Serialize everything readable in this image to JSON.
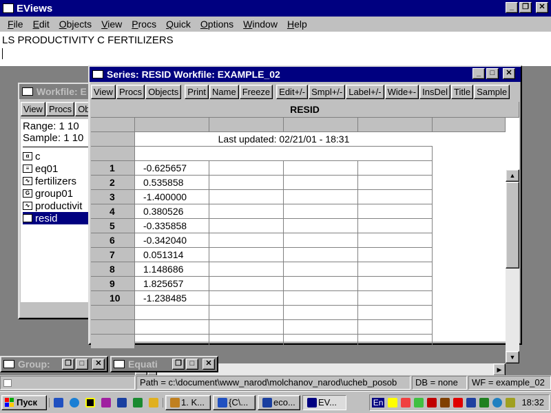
{
  "app": {
    "title": "EViews"
  },
  "menu": [
    "File",
    "Edit",
    "Objects",
    "View",
    "Procs",
    "Quick",
    "Options",
    "Window",
    "Help"
  ],
  "command": {
    "text": "LS PRODUCTIVITY C  FERTILIZERS"
  },
  "workfile_window": {
    "title": "Workfile: E",
    "toolbar": [
      "View",
      "Procs",
      "Ob"
    ],
    "range": "Range:   1 10",
    "sample": "Sample: 1 10",
    "items": [
      {
        "icon": "alpha",
        "name": "c"
      },
      {
        "icon": "eq",
        "name": "eq01"
      },
      {
        "icon": "series",
        "name": "fertilizers"
      },
      {
        "icon": "group",
        "name": "group01"
      },
      {
        "icon": "series",
        "name": "productivit"
      },
      {
        "icon": "series",
        "name": "resid",
        "selected": true
      }
    ]
  },
  "series_window": {
    "title": "Series: RESID   Workfile: EXAMPLE_02",
    "toolbar": [
      "View",
      "Procs",
      "Objects",
      "Print",
      "Name",
      "Freeze",
      "Edit+/-",
      "Smpl+/-",
      "Label+/-",
      "Wide+-",
      "InsDel",
      "Title",
      "Sample"
    ],
    "header": "RESID",
    "last_updated": "Last updated: 02/21/01 - 18:31",
    "rows": [
      {
        "obs": "1",
        "value": "-0.625657"
      },
      {
        "obs": "2",
        "value": "0.535858"
      },
      {
        "obs": "3",
        "value": "-1.400000"
      },
      {
        "obs": "4",
        "value": "0.380526"
      },
      {
        "obs": "5",
        "value": "-0.335858"
      },
      {
        "obs": "6",
        "value": "-0.342040"
      },
      {
        "obs": "7",
        "value": "0.051314"
      },
      {
        "obs": "8",
        "value": "1.148686"
      },
      {
        "obs": "9",
        "value": "1.825657"
      },
      {
        "obs": "10",
        "value": "-1.238485"
      }
    ]
  },
  "minimized": [
    {
      "title": "Group:"
    },
    {
      "title": "Equati"
    }
  ],
  "statusbar": {
    "path": "Path = c:\\document\\www_narod\\molchanov_narod\\ucheb_posob",
    "db": "DB = none",
    "wf": "WF = example_02"
  },
  "taskbar": {
    "start": "Пуск",
    "tasks": [
      "1. K...",
      "{C\\...",
      "eco...",
      "EV..."
    ],
    "lang": "En",
    "clock": "18:32"
  }
}
